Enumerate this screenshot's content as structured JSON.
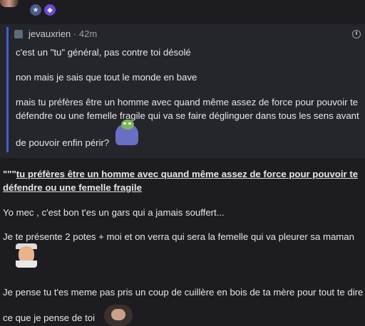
{
  "quoted_message": {
    "author": "jevauxrien",
    "separator": "·",
    "time": "42m",
    "lines": [
      "c'est un \"tu\" général, pas contre toi désolé",
      "non mais je sais que tout le monde en bave",
      "mais tu préfères être un homme avec quand même assez de force pour pouvoir te",
      "défendre ou une femelle fragile qui va se faire déglinguer dans tous les sens avant",
      "de pouvoir enfin périr?"
    ],
    "icons": [
      "clock-icon"
    ]
  },
  "reply": {
    "quote_prefix": "\"\"\"",
    "quote_line_1": "tu préfères être un homme avec quand même assez de force pour pouvoir te",
    "quote_line_2": "défendre ou une femelle fragile",
    "paragraphs": [
      "Yo mec , c'est bon t'es un gars qui a jamais souffert...",
      "Je te présente 2 potes + moi et on verra qui sera la femelle qui va pleurer sa maman",
      "Je pense tu t'es meme pas pris un coup de cuillère en bois de ta mère pour tout te dire",
      "ce que je pense de toi"
    ]
  },
  "colors": {
    "background": "#1c1c21",
    "quote_background": "#25262c",
    "quote_bar": "#3e5fd6"
  }
}
